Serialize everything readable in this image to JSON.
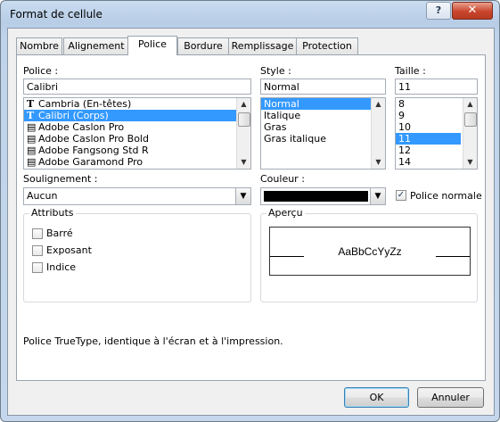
{
  "window": {
    "title": "Format de cellule",
    "help_icon": "?",
    "close_icon": "✕"
  },
  "tabs": [
    {
      "label": "Nombre",
      "active": false
    },
    {
      "label": "Alignement",
      "active": false
    },
    {
      "label": "Police",
      "active": true
    },
    {
      "label": "Bordure",
      "active": false
    },
    {
      "label": "Remplissage",
      "active": false
    },
    {
      "label": "Protection",
      "active": false
    }
  ],
  "font": {
    "label": "Police :",
    "value": "Calibri",
    "items": [
      {
        "label": "Cambria (En-têtes)",
        "icon": "truetype-icon",
        "selected": false
      },
      {
        "label": "Calibri (Corps)",
        "icon": "truetype-icon",
        "selected": true
      },
      {
        "label": "Adobe Caslon Pro",
        "icon": "opentype-icon",
        "selected": false
      },
      {
        "label": "Adobe Caslon Pro Bold",
        "icon": "opentype-icon",
        "selected": false
      },
      {
        "label": "Adobe Fangsong Std R",
        "icon": "opentype-icon",
        "selected": false
      },
      {
        "label": "Adobe Garamond Pro",
        "icon": "opentype-icon",
        "selected": false
      }
    ]
  },
  "style": {
    "label": "Style :",
    "value": "Normal",
    "items": [
      {
        "label": "Normal",
        "selected": true
      },
      {
        "label": "Italique",
        "selected": false
      },
      {
        "label": "Gras",
        "selected": false
      },
      {
        "label": "Gras italique",
        "selected": false
      }
    ]
  },
  "size": {
    "label": "Taille :",
    "value": "11",
    "items": [
      {
        "label": "8",
        "selected": false
      },
      {
        "label": "9",
        "selected": false
      },
      {
        "label": "10",
        "selected": false
      },
      {
        "label": "11",
        "selected": true
      },
      {
        "label": "12",
        "selected": false
      },
      {
        "label": "14",
        "selected": false
      }
    ]
  },
  "underline": {
    "label": "Soulignement :",
    "value": "Aucun"
  },
  "color": {
    "label": "Couleur :",
    "swatch": "#000000",
    "normal_font_label": "Police normale",
    "normal_font_checked": true
  },
  "attributes": {
    "title": "Attributs",
    "items": [
      {
        "label": "Barré",
        "checked": false
      },
      {
        "label": "Exposant",
        "checked": false
      },
      {
        "label": "Indice",
        "checked": false
      }
    ]
  },
  "preview": {
    "title": "Aperçu",
    "sample": "AaBbCcYyZz"
  },
  "description": "Police TrueType, identique à l'écran et à l'impression.",
  "buttons": {
    "ok": "OK",
    "cancel": "Annuler"
  }
}
